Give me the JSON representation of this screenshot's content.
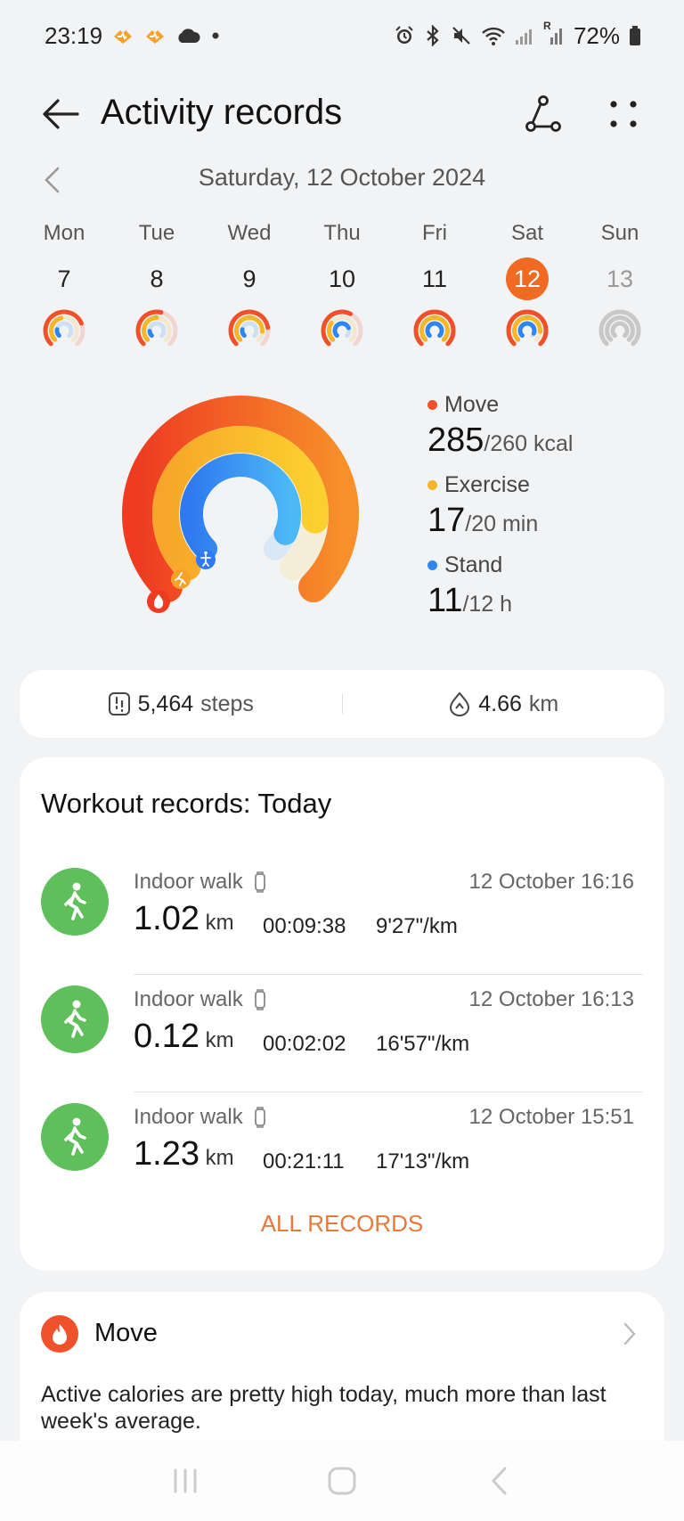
{
  "status_bar": {
    "time": "23:19",
    "battery": "72%",
    "signal_mark": "R"
  },
  "header": {
    "title": "Activity records"
  },
  "date_nav": {
    "current_date": "Saturday, 12 October 2024"
  },
  "week": [
    {
      "name": "Mon",
      "num": "7",
      "move": 0.75,
      "exercise": 0.45,
      "stand": 0.2
    },
    {
      "name": "Tue",
      "num": "8",
      "move": 0.55,
      "exercise": 0.5,
      "stand": 0.15
    },
    {
      "name": "Wed",
      "num": "9",
      "move": 0.8,
      "exercise": 0.85,
      "stand": 0.2
    },
    {
      "name": "Thu",
      "num": "10",
      "move": 0.6,
      "exercise": 0.3,
      "stand": 0.75
    },
    {
      "name": "Fri",
      "num": "11",
      "move": 1.0,
      "exercise": 1.0,
      "stand": 1.0
    },
    {
      "name": "Sat",
      "num": "12",
      "move": 1.0,
      "exercise": 0.85,
      "stand": 0.92
    },
    {
      "name": "Sun",
      "num": "13",
      "move": 0,
      "exercise": 0,
      "stand": 0
    }
  ],
  "summary": {
    "move": {
      "label": "Move",
      "value": "285",
      "goal": "/260 kcal",
      "progress": 1.0
    },
    "exercise": {
      "label": "Exercise",
      "value": "17",
      "goal": "/20 min",
      "progress": 0.85
    },
    "stand": {
      "label": "Stand",
      "value": "11",
      "goal": "/12 h",
      "progress": 0.92
    }
  },
  "steps": {
    "value": "5,464",
    "unit": "steps"
  },
  "distance": {
    "value": "4.66",
    "unit": "km"
  },
  "workouts": {
    "title": "Workout records: Today",
    "items": [
      {
        "name": "Indoor walk",
        "date": "12 October",
        "time": "16:16",
        "distance": "1.02",
        "unit": "km",
        "duration": "00:09:38",
        "pace": "9'27\"/km"
      },
      {
        "name": "Indoor walk",
        "date": "12 October",
        "time": "16:13",
        "distance": "0.12",
        "unit": "km",
        "duration": "00:02:02",
        "pace": "16'57\"/km"
      },
      {
        "name": "Indoor walk",
        "date": "12 October",
        "time": "15:51",
        "distance": "1.23",
        "unit": "km",
        "duration": "00:21:11",
        "pace": "17'13\"/km"
      }
    ],
    "all_records": "ALL RECORDS"
  },
  "move_card": {
    "title": "Move",
    "text": "Active calories are pretty high today, much more than last week's average."
  },
  "colors": {
    "move": "#f0502a",
    "exercise": "#f5b62a",
    "stand": "#2f86f0",
    "selected_day": "#f06a22",
    "workout_icon": "#5fbf5a",
    "accent_link": "#e57a3c"
  }
}
